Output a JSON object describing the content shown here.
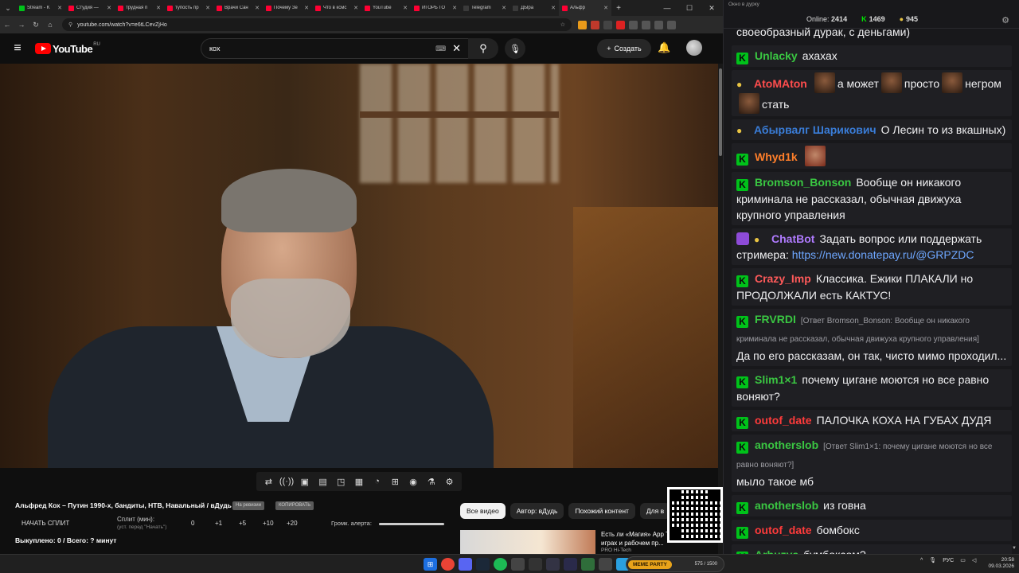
{
  "browser": {
    "tabs": [
      {
        "label": "Stream - K",
        "color": "#00c21a"
      },
      {
        "label": "Студия —",
        "color": "#ff0033"
      },
      {
        "label": "трудная п",
        "color": "#ff0033"
      },
      {
        "label": "тупость пр",
        "color": "#ff0033"
      },
      {
        "label": "Врачи Сан",
        "color": "#ff0033"
      },
      {
        "label": "Почему Зе",
        "color": "#ff0033"
      },
      {
        "label": "Что в ксмс",
        "color": "#ff0033"
      },
      {
        "label": "YouTube",
        "color": "#ff0033"
      },
      {
        "label": "ИГОРЬ ГО",
        "color": "#ff0033"
      },
      {
        "label": "Telegram",
        "color": "#3a3a3a"
      },
      {
        "label": "ДЫра",
        "color": "#3a3a3a"
      },
      {
        "label": "Альфр",
        "color": "#ff0033"
      }
    ],
    "url": "youtube.com/watch?v=e6tLCevZjHo"
  },
  "youtube": {
    "logo_text": "YouTube",
    "region": "RU",
    "search_value": "кох",
    "create_label": "Создать",
    "video_title": "Альфред Кох – Путин 1990-х, бандиты, НТВ, Навальный / вДудь",
    "pill_1": "На ревизии",
    "pill_2": "КОПИРОВАТЬ",
    "split_button": "НАЧАТЬ СПЛИТ",
    "split_label": "Сплит (мин):",
    "split_hint": "(уст. перед \"Начать\")",
    "split_values": [
      "0",
      "+1",
      "+5",
      "+10",
      "+20"
    ],
    "alert_label": "Громк. алерта:",
    "bought_text": "Выкуплено: 0 / Всего: ? минут",
    "chips": [
      "Все видео",
      "Автор: вДудь",
      "Похожий контент",
      "Для в"
    ],
    "rec_title": "Есть ли «Магия» App Тест в играх и рабочем пр...",
    "rec_author": "PRO Hi-Tech"
  },
  "chat": {
    "title": "Окно в дурку",
    "online_label": "Online:",
    "online_value": "2414",
    "k_count": "1469",
    "coin_count": "945",
    "messages": [
      {
        "nick": "",
        "color": "#ffffff",
        "text": "своеобразный дурак, с деньгами)"
      },
      {
        "nick": "Unlacky",
        "color": "#3ac742",
        "text": "ахахах"
      },
      {
        "nick": "AtoMAton",
        "color": "#ff4d4d",
        "text": "а может",
        "text2": "просто",
        "text3": "негром",
        "text4": "стать"
      },
      {
        "nick": "Абырвалг Шарикович",
        "color": "#3a7dd8",
        "text": "О Лесин то из вкашных)"
      },
      {
        "nick": "Whyd1k",
        "color": "#ff7f2a",
        "text": ""
      },
      {
        "nick": "Bromson_Bonson",
        "color": "#3ac742",
        "text": "Вообще он никакого криминала не рассказал, обычная движуха крупного управления"
      },
      {
        "nick": "ChatBot",
        "color": "#b07bff",
        "text": "Задать вопрос или поддержать стримера:",
        "link": "https://new.donatepay.ru/@GRPZDC"
      },
      {
        "nick": "Crazy_Imp",
        "color": "#ff5a5a",
        "text": "Классика. Ежики ПЛАКАЛИ но ПРОДОЛЖАЛИ есть КАКТУС!"
      },
      {
        "nick": "FRVRDI",
        "color": "#3ac742",
        "reply": "[Ответ Bromson_Bonson: Вообще он никакого криминала не рассказал, обычная движуха крупного управления]",
        "text": "Да по его рассказам, он так, чисто мимо проходил..."
      },
      {
        "nick": "Slim1×1",
        "color": "#3ac742",
        "text": "почему цигане моются но все равно воняют?"
      },
      {
        "nick": "outof_date",
        "color": "#ff3b3b",
        "text": "ПАЛОЧКА КОХА НА ГУБАХ ДУДЯ"
      },
      {
        "nick": "anotherslob",
        "color": "#3ac742",
        "reply": "[Ответ Slim1×1: почему цигане моются но все равно воняют?]",
        "text": "мыло такое мб"
      },
      {
        "nick": "anotherslob",
        "color": "#3ac742",
        "text": "из говна"
      },
      {
        "nick": "outof_date",
        "color": "#ff3b3b",
        "text": "бомбокс"
      },
      {
        "nick": "Arbuzya",
        "color": "#3ac742",
        "text": "бумбоксом?"
      }
    ]
  },
  "taskbar": {
    "meme_tag": "MEME PARTY",
    "meme_count": "575 / 1500",
    "lang": "РУС",
    "time": "20:58",
    "date": "09.03.2026"
  }
}
